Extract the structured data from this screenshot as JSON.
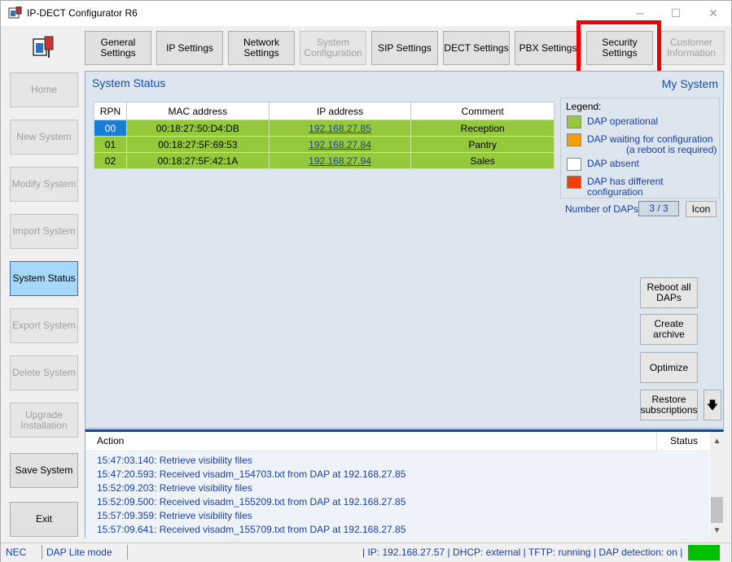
{
  "window": {
    "title": "IP-DECT Configurator R6"
  },
  "tabs": [
    {
      "label": "General Settings",
      "enabled": true
    },
    {
      "label": "IP Settings",
      "enabled": true
    },
    {
      "label": "Network Settings",
      "enabled": true
    },
    {
      "label": "System Configuration",
      "enabled": false
    },
    {
      "label": "SIP Settings",
      "enabled": true
    },
    {
      "label": "DECT Settings",
      "enabled": true
    },
    {
      "label": "PBX Settings",
      "enabled": true
    },
    {
      "label": "Security Settings",
      "enabled": true
    },
    {
      "label": "Customer Information",
      "enabled": false
    }
  ],
  "sidebar": [
    {
      "label": "Home",
      "enabled": false
    },
    {
      "label": "New System",
      "enabled": false
    },
    {
      "label": "Modify System",
      "enabled": false
    },
    {
      "label": "Import System",
      "enabled": false
    },
    {
      "label": "System Status",
      "enabled": true,
      "active": true
    },
    {
      "label": "Export System",
      "enabled": false
    },
    {
      "label": "Delete System",
      "enabled": false
    },
    {
      "label": "Upgrade Installation",
      "enabled": false
    },
    {
      "label": "Save System",
      "enabled": true
    },
    {
      "label": "Exit",
      "enabled": true
    }
  ],
  "panel": {
    "title": "System Status",
    "system_name": "My System"
  },
  "table": {
    "headers": [
      "RPN",
      "MAC address",
      "IP address",
      "Comment"
    ],
    "rows": [
      {
        "rpn": "00",
        "mac": "00:18:27:50:D4:DB",
        "ip": "192.168.27.85",
        "comment": "Reception"
      },
      {
        "rpn": "01",
        "mac": "00:18:27:5F:69:53",
        "ip": "192.168.27.84",
        "comment": "Pantry"
      },
      {
        "rpn": "02",
        "mac": "00:18:27:5F:42:1A",
        "ip": "192.168.27.94",
        "comment": "Sales"
      }
    ]
  },
  "legend": {
    "title": "Legend:",
    "items": [
      {
        "label": "DAP operational",
        "color": "#96c83c"
      },
      {
        "label": "DAP waiting for configuration",
        "sub": "(a reboot is required)",
        "color": "#f5a000"
      },
      {
        "label": "DAP absent",
        "color": "#ffffff"
      },
      {
        "label": "DAP has different configuration",
        "color": "#f04000"
      }
    ]
  },
  "daps": {
    "label": "Number of DAPs",
    "value": "3 / 3",
    "icon_button": "Icon"
  },
  "actions": {
    "reboot": "Reboot all DAPs",
    "archive": "Create archive",
    "optimize": "Optimize",
    "restore": "Restore subscriptions"
  },
  "log": {
    "action_header": "Action",
    "status_header": "Status",
    "lines": [
      "15:47:03.140: Retrieve visibility files",
      "15:47:20.593: Received visadm_154703.txt from DAP at 192.168.27.85",
      "15:52:09.203: Retrieve visibility files",
      "15:52:09.500: Received visadm_155209.txt from DAP at 192.168.27.85",
      "15:57:09.359: Retrieve visibility files",
      "15:57:09.641: Received visadm_155709.txt from DAP at 192.168.27.85"
    ]
  },
  "statusbar": {
    "vendor": "NEC",
    "mode": "DAP Lite mode",
    "info": "| IP: 192.168.27.57 | DHCP: external | TFTP: running | DAP detection: on |",
    "indicator_color": "#00c000"
  }
}
